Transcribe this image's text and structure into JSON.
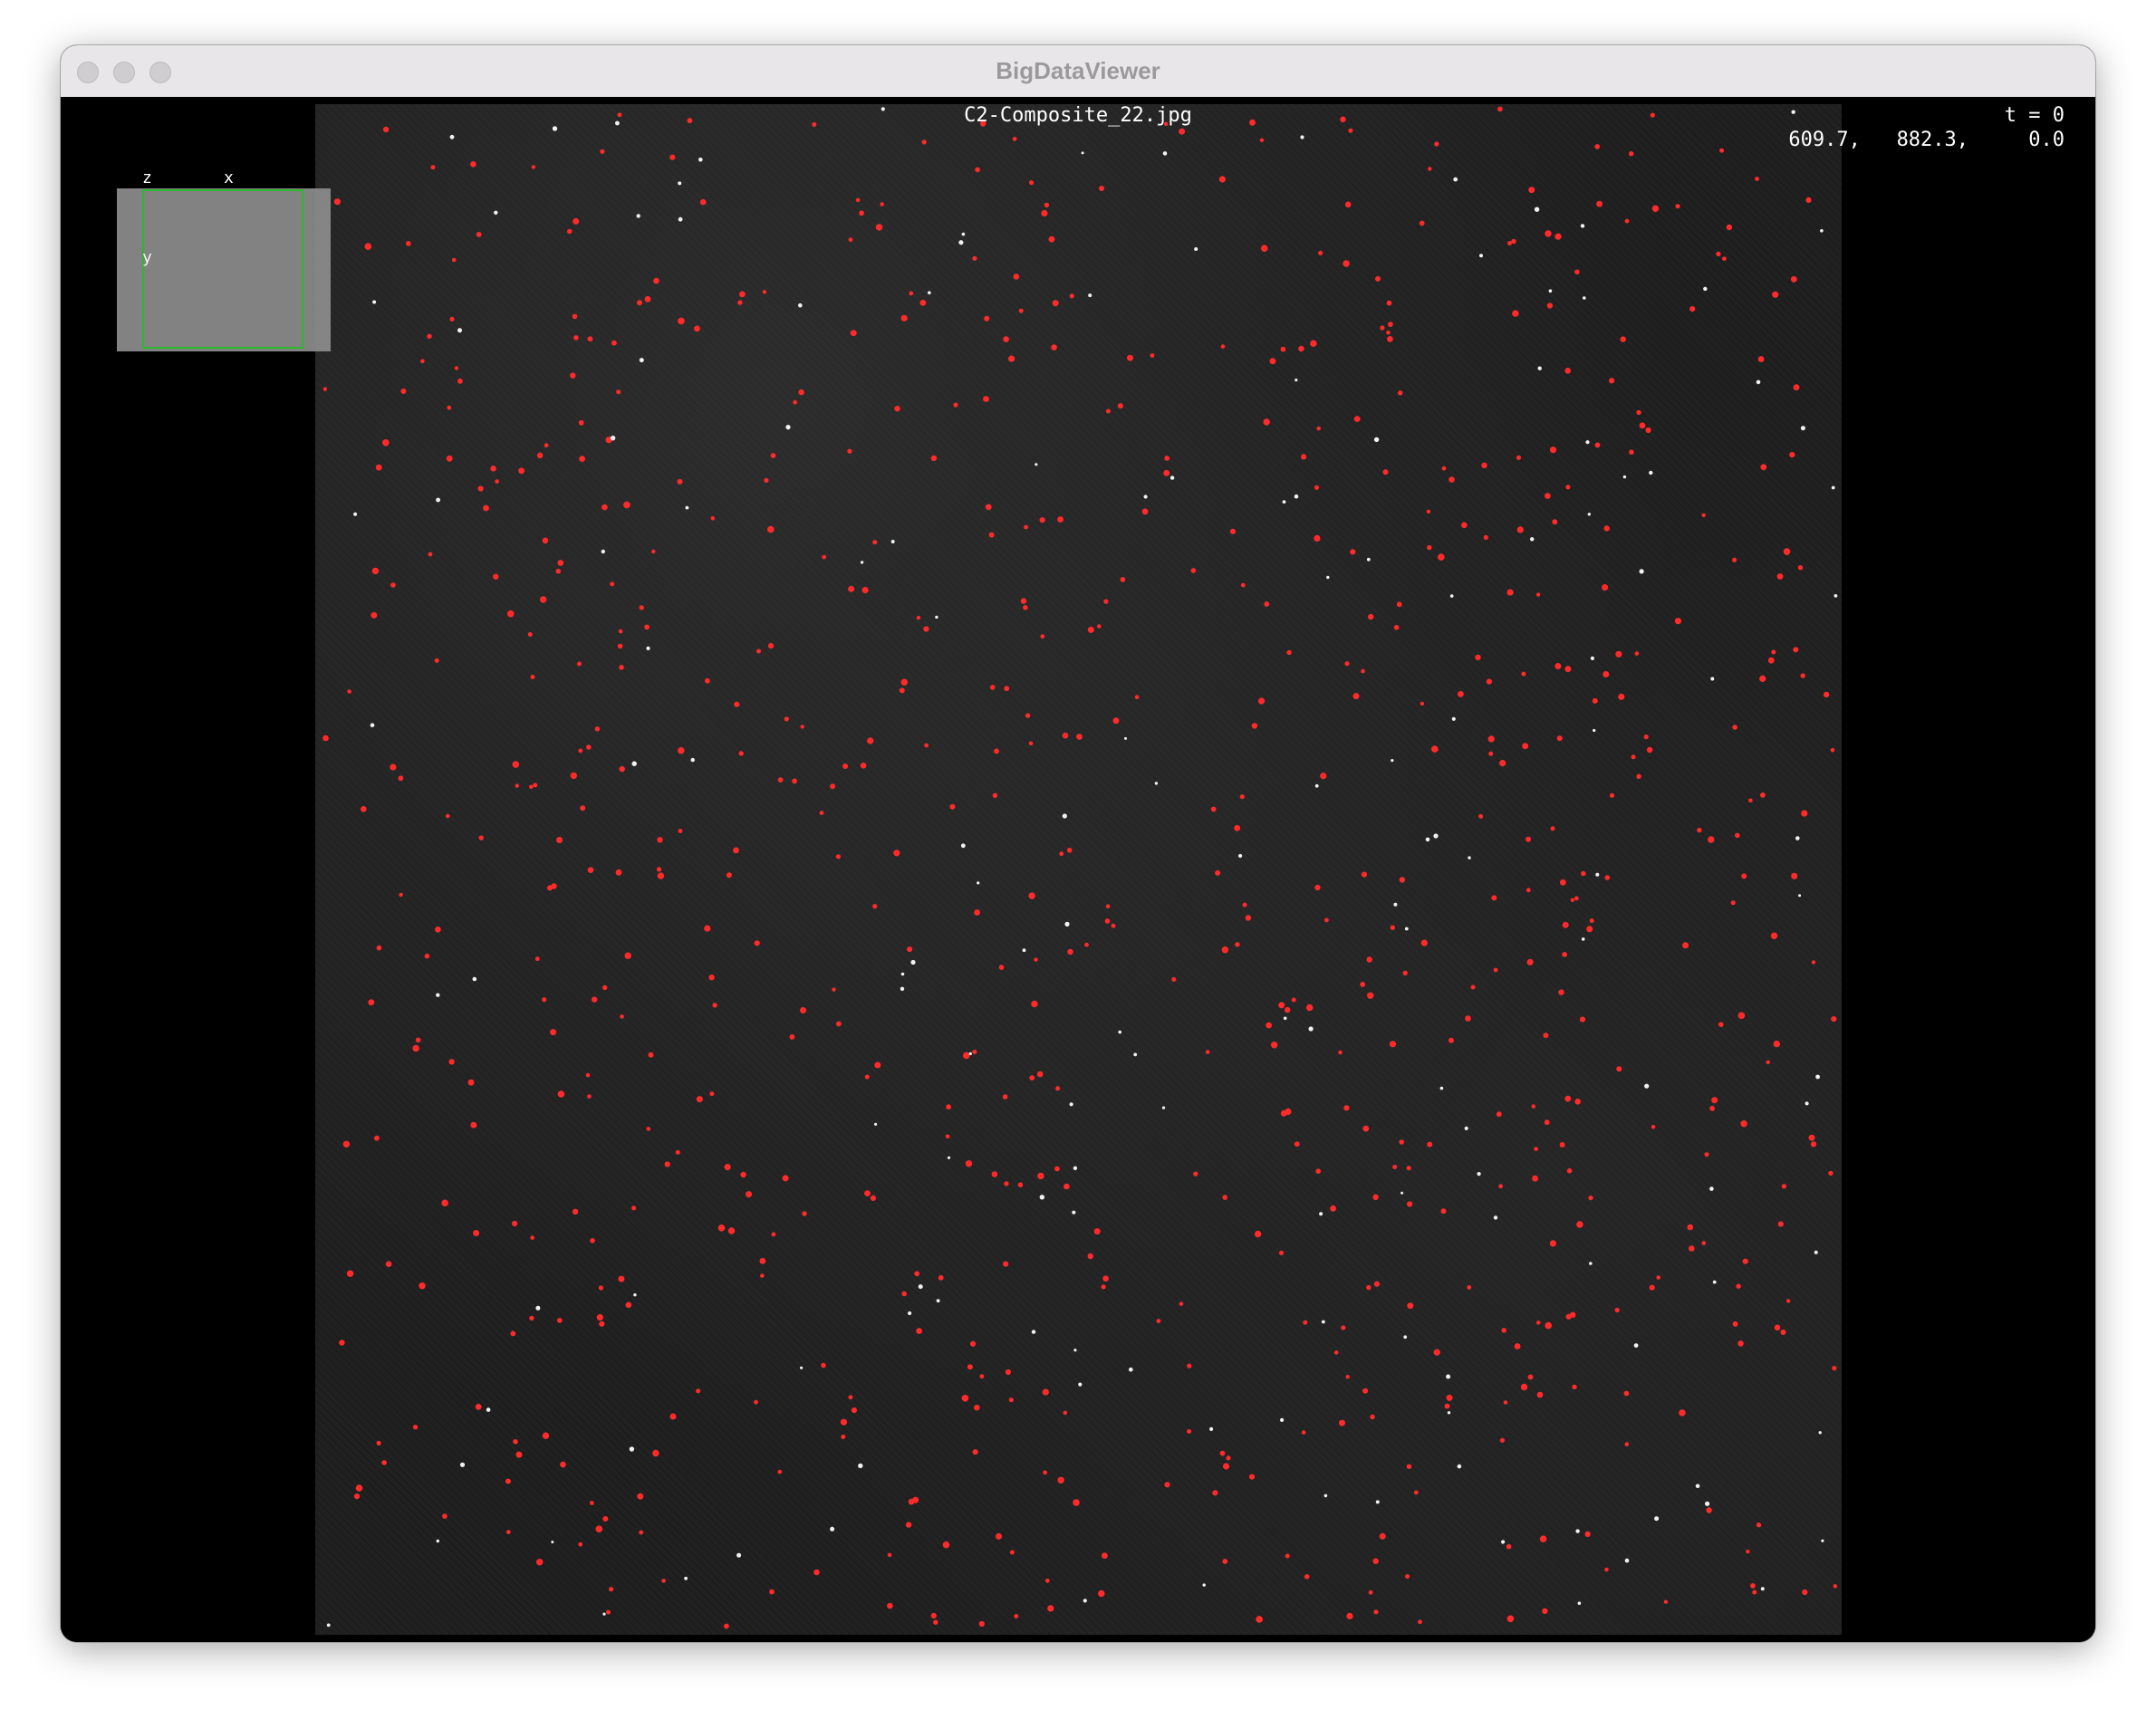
{
  "window": {
    "title": "BigDataViewer"
  },
  "viewer": {
    "image_name": "C2-Composite_22.jpg",
    "timepoint": "t = 0",
    "coordinates": "609.7,   882.3,     0.0",
    "navigator": {
      "axis_z": "z",
      "axis_x": "x",
      "axis_y": "y"
    }
  },
  "colors": {
    "spot": "#ff2a2a",
    "navigator_frame": "#2fc22f",
    "background": "#000000"
  }
}
